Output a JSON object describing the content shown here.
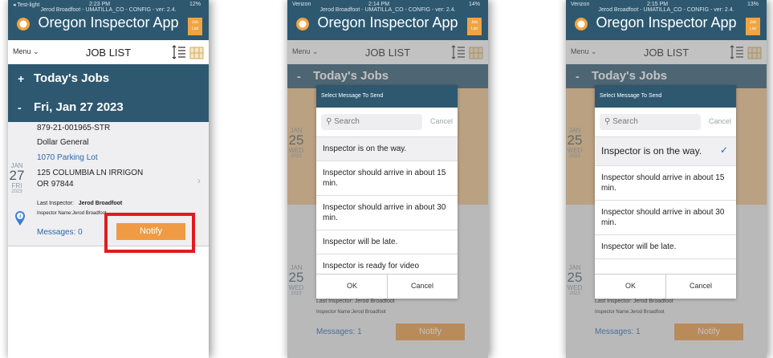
{
  "app": {
    "subtitle": "Jerod Broadfoot - UMATILLA_CO - CONFIG - ver: 2.4.",
    "title": "Oregon Inspector App",
    "joblist_line1": "Job",
    "joblist_line2": "List",
    "menu_label": "Menu ⌄",
    "list_title": "JOB LIST"
  },
  "screens": [
    {
      "status": {
        "carrier": "◂ Test-light",
        "time": "2:23 PM",
        "battery": "12%"
      },
      "groups": [
        {
          "sign": "+",
          "label": "Today's Jobs"
        },
        {
          "sign": "-",
          "label": "Fri, Jan 27 2023"
        }
      ],
      "job": {
        "id": "879-21-001965-STR",
        "name": "Dollar General",
        "type": "1070 Parking Lot",
        "address1": "125 COLUMBIA LN IRRIGON",
        "address2": "OR 97844",
        "date": {
          "month": "JAN",
          "day": "27",
          "dow": "FRI",
          "year": "2023"
        },
        "last_inspector_label": "Last Inspector:",
        "last_inspector": "Jerod Broadfoot",
        "inspector_name": "Inspector Name:Jerod Broadfoot",
        "pin_number": "4",
        "messages": "Messages: 0",
        "notify": "Notify"
      }
    },
    {
      "status": {
        "carrier": "Verizon",
        "time": "2:14 PM",
        "battery": "14%"
      },
      "groups": [
        {
          "sign": "-",
          "label": "Today's Jobs"
        }
      ],
      "date": {
        "month": "JAN",
        "day": "25",
        "dow": "WED",
        "year": "2023"
      },
      "lower_date": {
        "month": "JAN",
        "day": "25",
        "dow": "WED",
        "year": "2023"
      },
      "last_inspector": "Last Inspector:   Jerod Broadfoot",
      "inspector_name": "Inspector Name:Jerod Broadfoot",
      "messages": "Messages: 1",
      "notify": "Notify",
      "dialog": {
        "title": "Select Message To Send",
        "search_placeholder": "Search",
        "search_cancel": "Cancel",
        "options": [
          "Inspector is on the way.",
          "Inspector should arrive in about 15 min.",
          "Inspector should arrive in about 30 min.",
          "Inspector will be late.",
          "Inspector is ready for video"
        ],
        "ok": "OK",
        "cancel": "Cancel"
      }
    },
    {
      "status": {
        "carrier": "Verizon",
        "time": "2:15 PM",
        "battery": "13%"
      },
      "groups": [
        {
          "sign": "-",
          "label": "Today's Jobs"
        }
      ],
      "date": {
        "month": "JAN",
        "day": "25",
        "dow": "WED",
        "year": "2023"
      },
      "lower_date": {
        "month": "JAN",
        "day": "25",
        "dow": "WED",
        "year": "2023"
      },
      "last_inspector": "Last Inspector:   Jerod Broadfoot",
      "inspector_name": "Inspector Name:Jerod Broadfoot",
      "messages": "Messages: 1",
      "notify": "Notify",
      "dialog": {
        "title": "Select Message To Send",
        "search_placeholder": "Search",
        "search_cancel": "Cancel",
        "options": [
          "Inspector is on the way.",
          "Inspector should arrive in about 15 min.",
          "Inspector should arrive in about 30 min.",
          "Inspector will be late."
        ],
        "selected_index": 0,
        "ok": "OK",
        "cancel": "Cancel"
      }
    }
  ],
  "colors": {
    "header": "#2d5870",
    "notify": "#ef9b43",
    "highlight": "#e01b22",
    "link": "#2a66b0"
  }
}
